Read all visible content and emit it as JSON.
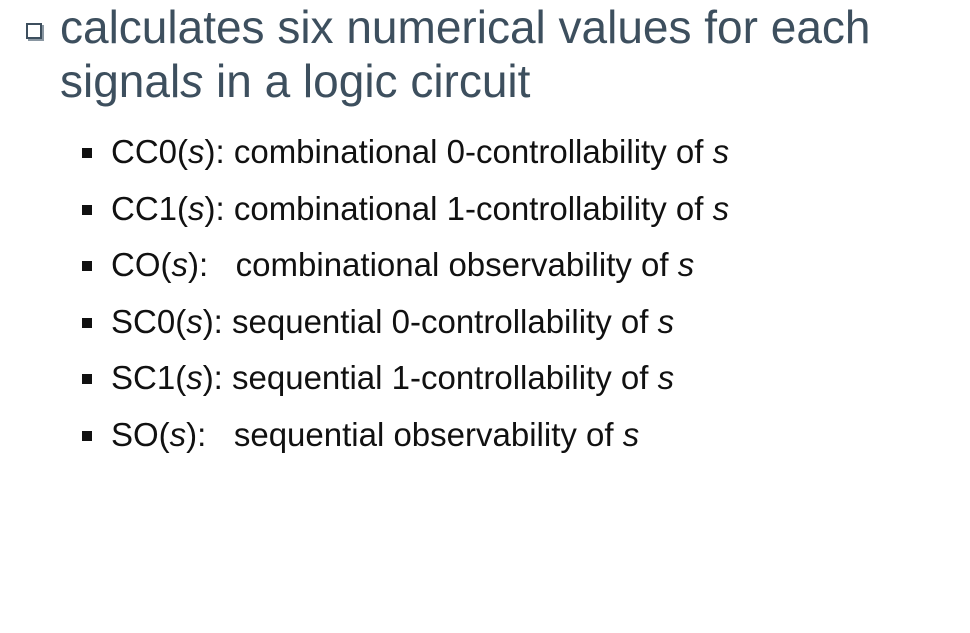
{
  "main_bullet": {
    "line1": "calculates six numerical values for each",
    "line2_before": "signal",
    "line2_italic": "s",
    "line2_after": " in a logic circuit"
  },
  "sub_items": [
    {
      "prefix": "CC0(",
      "var": "s",
      "suffix": "): combinational 0-controllability of ",
      "end_var": "s"
    },
    {
      "prefix": "CC1(",
      "var": "s",
      "suffix": "): combinational 1-controllability of ",
      "end_var": "s"
    },
    {
      "prefix": "CO(",
      "var": "s",
      "suffix": "):   combinational observability of ",
      "end_var": "s"
    },
    {
      "prefix": "SC0(",
      "var": "s",
      "suffix": "): sequential 0-controllability of ",
      "end_var": "s"
    },
    {
      "prefix": "SC1(",
      "var": "s",
      "suffix": "): sequential 1-controllability of ",
      "end_var": "s"
    },
    {
      "prefix": "SO(",
      "var": "s",
      "suffix": "):   sequential observability of ",
      "end_var": "s"
    }
  ]
}
